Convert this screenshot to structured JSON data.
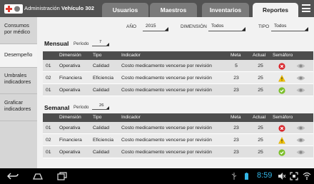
{
  "header": {
    "title_prefix": "Administración",
    "title_bold": "Vehículo 302",
    "tabs": [
      {
        "label": "Usuarios"
      },
      {
        "label": "Maestros"
      },
      {
        "label": "Inventarios"
      },
      {
        "label": "Reportes"
      }
    ]
  },
  "sidebar": {
    "items": [
      {
        "label": "Consumos por médico"
      },
      {
        "label": "Desempeño"
      },
      {
        "label": "Umbrales indicadores"
      },
      {
        "label": "Graficar indicadores"
      }
    ]
  },
  "filters": {
    "year_label": "AÑO",
    "year_value": "2015",
    "dimension_label": "DIMENSIÓN",
    "dimension_value": "Todos",
    "type_label": "TIPO",
    "type_value": "Todos"
  },
  "columns": [
    "Dimensión",
    "Tipo",
    "Indicador",
    "Meta",
    "Actual",
    "Semáforo"
  ],
  "mensual": {
    "title": "Mensual",
    "period_label": "Período",
    "period_value": "7",
    "rows": [
      {
        "num": "01",
        "dimension": "Operativa",
        "tipo": "Calidad",
        "indicador": "Costo medicamento vencerse por revisión",
        "meta": "5",
        "actual": "25",
        "semaforo": "red-x"
      },
      {
        "num": "02",
        "dimension": "Financiera",
        "tipo": "Eficiencia",
        "indicador": "Costo medicamento vencerse por revisión",
        "meta": "23",
        "actual": "25",
        "semaforo": "warning"
      },
      {
        "num": "01",
        "dimension": "Operativa",
        "tipo": "Calidad",
        "indicador": "Costo medicamento vencerse por revisión",
        "meta": "23",
        "actual": "25",
        "semaforo": "green-check"
      }
    ]
  },
  "semanal": {
    "title": "Semanal",
    "period_label": "Período",
    "period_value": "26",
    "rows": [
      {
        "num": "01",
        "dimension": "Operativa",
        "tipo": "Calidad",
        "indicador": "Costo medicamento vencerse por revisión",
        "meta": "23",
        "actual": "25",
        "semaforo": "red-x"
      },
      {
        "num": "02",
        "dimension": "Financiera",
        "tipo": "Eficiencia",
        "indicador": "Costo medicamento vencerse por revisión",
        "meta": "23",
        "actual": "25",
        "semaforo": "warning"
      },
      {
        "num": "01",
        "dimension": "Operativa",
        "tipo": "Calidad",
        "indicador": "Costo medicamento vencerse por revisión",
        "meta": "23",
        "actual": "25",
        "semaforo": "green-check"
      }
    ]
  },
  "statusbar": {
    "time": "8:59"
  },
  "colors": {
    "header_bg": "#525252",
    "tab_inactive": "#7b7b7b",
    "table_header": "#4d4d4d",
    "clock": "#33b5e5",
    "status_red": "#d9262c",
    "status_yellow": "#f5c400",
    "status_green": "#7bbf2a"
  }
}
